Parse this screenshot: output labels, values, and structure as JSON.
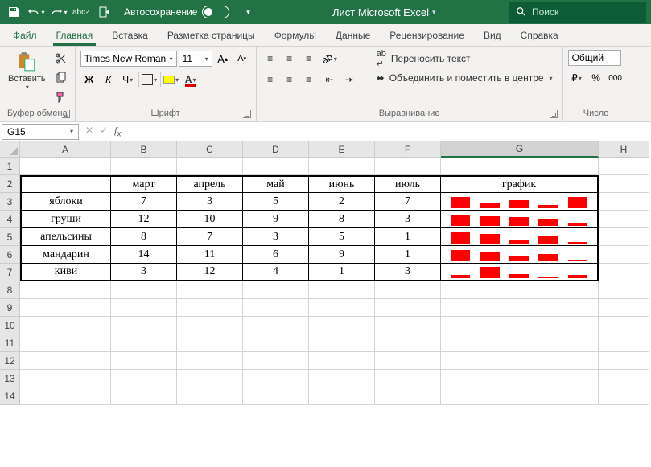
{
  "title": "Лист Microsoft Excel",
  "autosave_label": "Автосохранение",
  "search_placeholder": "Поиск",
  "tabs": {
    "file": "Файл",
    "home": "Главная",
    "insert": "Вставка",
    "layout": "Разметка страницы",
    "formulas": "Формулы",
    "data": "Данные",
    "review": "Рецензирование",
    "view": "Вид",
    "help": "Справка"
  },
  "ribbon": {
    "clipboard": {
      "label": "Буфер обмена",
      "paste": "Вставить"
    },
    "font": {
      "label": "Шрифт",
      "name": "Times New Roman",
      "size": "11",
      "bold": "Ж",
      "italic": "К",
      "underline": "Ч"
    },
    "alignment": {
      "label": "Выравнивание",
      "wrap": "Переносить текст",
      "merge": "Объединить и поместить в центре"
    },
    "number": {
      "label": "Число",
      "format": "Общий"
    }
  },
  "name_box": "G15",
  "formula": "",
  "col_headers": [
    "A",
    "B",
    "C",
    "D",
    "E",
    "F",
    "G",
    "H"
  ],
  "row_headers": [
    "1",
    "2",
    "3",
    "4",
    "5",
    "6",
    "7",
    "8",
    "9",
    "10",
    "11",
    "12",
    "13",
    "14"
  ],
  "table": {
    "months": [
      "март",
      "апрель",
      "май",
      "июнь",
      "июль"
    ],
    "chart_h": "график",
    "rows": [
      {
        "label": "яблоки",
        "v": [
          7,
          3,
          5,
          2,
          7
        ]
      },
      {
        "label": "груши",
        "v": [
          12,
          10,
          9,
          8,
          3
        ]
      },
      {
        "label": "апельсины",
        "v": [
          8,
          7,
          3,
          5,
          1
        ]
      },
      {
        "label": "мандарин",
        "v": [
          14,
          11,
          6,
          9,
          1
        ]
      },
      {
        "label": "киви",
        "v": [
          3,
          12,
          4,
          1,
          3
        ]
      }
    ]
  },
  "chart_data": {
    "type": "bar",
    "title": "график",
    "categories": [
      "март",
      "апрель",
      "май",
      "июнь",
      "июль"
    ],
    "series": [
      {
        "name": "яблоки",
        "values": [
          7,
          3,
          5,
          2,
          7
        ]
      },
      {
        "name": "груши",
        "values": [
          12,
          10,
          9,
          8,
          3
        ]
      },
      {
        "name": "апельсины",
        "values": [
          8,
          7,
          3,
          5,
          1
        ]
      },
      {
        "name": "мандарин",
        "values": [
          14,
          11,
          6,
          9,
          1
        ]
      },
      {
        "name": "киви",
        "values": [
          3,
          12,
          4,
          1,
          3
        ]
      }
    ]
  }
}
